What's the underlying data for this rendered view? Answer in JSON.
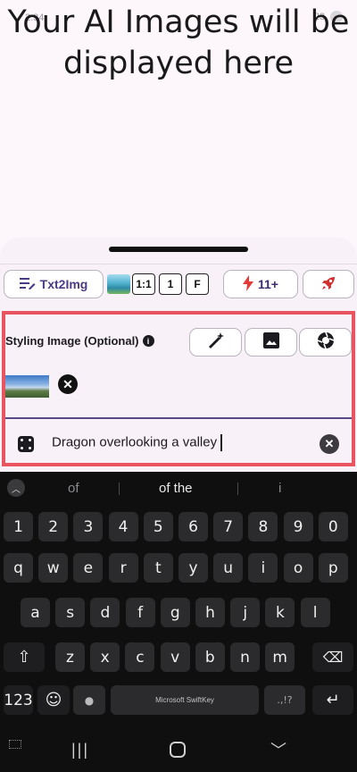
{
  "status": {
    "left": "2:34",
    "right": "23"
  },
  "headline": "Your AI Images will be displayed here",
  "toolbar": {
    "mode_label": "Txt2Img",
    "ratio": "1:1",
    "count": "1",
    "f": "F",
    "credits": "11+"
  },
  "styling": {
    "label": "Styling Image (Optional)",
    "info": "i"
  },
  "prompt": {
    "value": "Dragon overlooking a valley"
  },
  "keyboard": {
    "suggestions": [
      "of",
      "of the",
      "i"
    ],
    "row_numbers": [
      "1",
      "2",
      "3",
      "4",
      "5",
      "6",
      "7",
      "8",
      "9",
      "0"
    ],
    "row_top": [
      "q",
      "w",
      "e",
      "r",
      "t",
      "y",
      "u",
      "i",
      "o",
      "p"
    ],
    "row_mid": [
      "a",
      "s",
      "d",
      "f",
      "g",
      "h",
      "j",
      "k",
      "l"
    ],
    "row_bottom": [
      "z",
      "x",
      "c",
      "v",
      "b",
      "n",
      "m"
    ],
    "num_key": "123",
    "space_label": "Microsoft SwiftKey",
    "punct": ".,!?"
  },
  "colors": {
    "accent": "#4b3a86",
    "highlight_border": "#e85560",
    "credits_icon": "#e53935",
    "rocket_icon": "#d32f2f"
  }
}
